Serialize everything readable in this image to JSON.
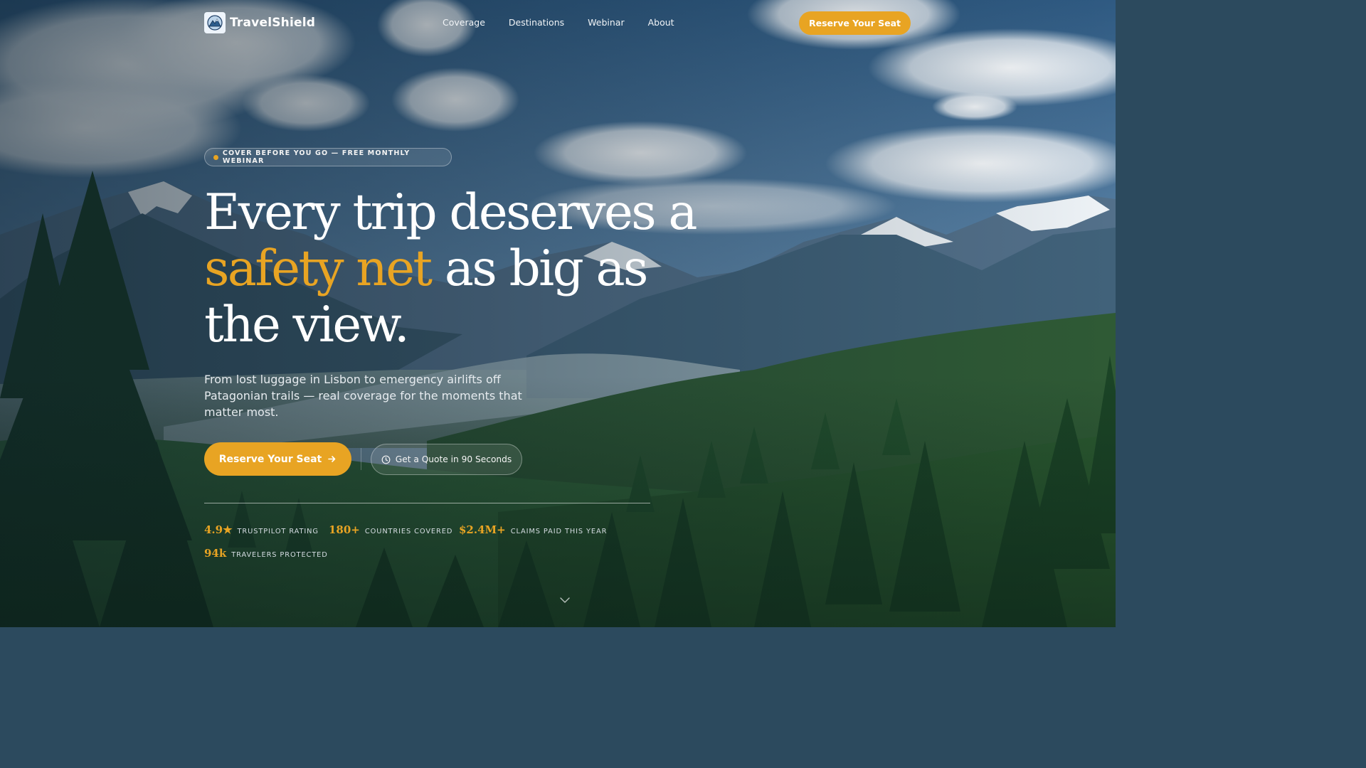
{
  "brand": {
    "name": "TravelShield",
    "logo_icon": "mountain-shield-icon"
  },
  "nav": {
    "links": [
      "Coverage",
      "Destinations",
      "Webinar",
      "About"
    ],
    "cta_label": "Reserve Your Seat"
  },
  "hero": {
    "badge": "COVER BEFORE YOU GO — FREE MONTHLY WEBINAR",
    "headline_pre": "Every trip deserves a ",
    "headline_accent": "safety net",
    "headline_post": " as big as the view.",
    "subtitle": "From lost luggage in Lisbon to emergency airlifts off Patagonian trails — real coverage for the moments that matter most.",
    "primary_cta": "Reserve Your Seat",
    "primary_cta_icon": "arrow-right-icon",
    "secondary_cta": "Get a Quote in 90 Seconds",
    "secondary_cta_icon": "clock-icon"
  },
  "stats": [
    {
      "value": "4.9★",
      "label": "TRUSTPILOT RATING"
    },
    {
      "value": "180+",
      "label": "COUNTRIES COVERED"
    },
    {
      "value": "$2.4M+",
      "label": "CLAIMS PAID THIS YEAR"
    },
    {
      "value": "94k",
      "label": "TRAVELERS PROTECTED"
    }
  ],
  "colors": {
    "accent": "#e8a423",
    "text": "#ffffff"
  },
  "scroll_icon": "chevron-down-icon"
}
